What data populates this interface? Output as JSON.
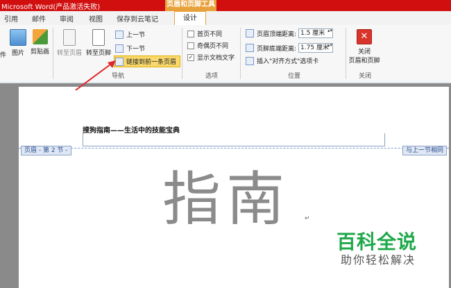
{
  "window": {
    "title": "Microsoft Word(产品激活失败)",
    "context_tool": "页眉和页脚工具"
  },
  "tabs": [
    {
      "label": "引用"
    },
    {
      "label": "邮件"
    },
    {
      "label": "审阅"
    },
    {
      "label": "视图"
    },
    {
      "label": "保存到云笔记"
    },
    {
      "label": "设计",
      "active": true
    }
  ],
  "ribbon": {
    "insert": {
      "partial_label": "件",
      "picture": "图片",
      "clipart": "剪贴画"
    },
    "nav": {
      "goto_header": "转至页眉",
      "goto_footer": "转至页脚",
      "prev_section": "上一节",
      "next_section": "下一节",
      "link_previous": "链接到前一条页眉",
      "group": "导航"
    },
    "options": {
      "diff_first": "首页不同",
      "diff_odd_even": "奇偶页不同",
      "show_text": "显示文档文字",
      "show_text_checked": true,
      "group": "选项"
    },
    "position": {
      "header_top_label": "页眉顶端距离:",
      "header_top_value": "1.5 厘米",
      "footer_bottom_label": "页脚底端距离:",
      "footer_bottom_value": "1.75 厘米",
      "insert_align": "插入\"对齐方式\"选项卡",
      "group": "位置"
    },
    "close": {
      "label_line1": "关闭",
      "label_line2": "页眉和页脚",
      "group": "关闭"
    }
  },
  "document": {
    "header_text": "搜狗指南——生活中的技能宝典",
    "header_tag": "页眉 - 第 2 节 -",
    "same_as_prev": "与上一节相同",
    "body_text": "指南"
  },
  "watermark": {
    "line1": "百科全说",
    "line2": "助你轻松解决"
  },
  "colors": {
    "title_red": "#d10f0f",
    "context_orange": "#e8a13a",
    "watermark_green": "#1fa84a"
  }
}
